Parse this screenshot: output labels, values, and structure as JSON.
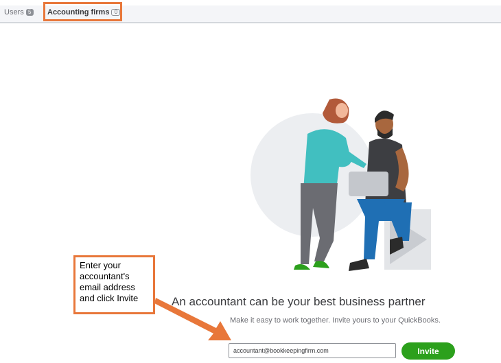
{
  "tabs": {
    "users_label": "Users",
    "users_count": "5",
    "accounting_label": "Accounting firms",
    "accounting_count": "0"
  },
  "main": {
    "headline": "An accountant can be your best business partner",
    "subline": "Make it easy to work together. Invite yours to your QuickBooks.",
    "email_value": "accountant@bookkeepingfirm.com",
    "invite_label": "Invite"
  },
  "callout": {
    "line1": "Enter your",
    "line2": "accountant's",
    "line3": "email address",
    "line4": "and click Invite"
  },
  "colors": {
    "accent_orange": "#e8773a",
    "invite_green": "#2ca01c"
  },
  "icons": [
    "accountant-illustration",
    "callout-arrow"
  ]
}
